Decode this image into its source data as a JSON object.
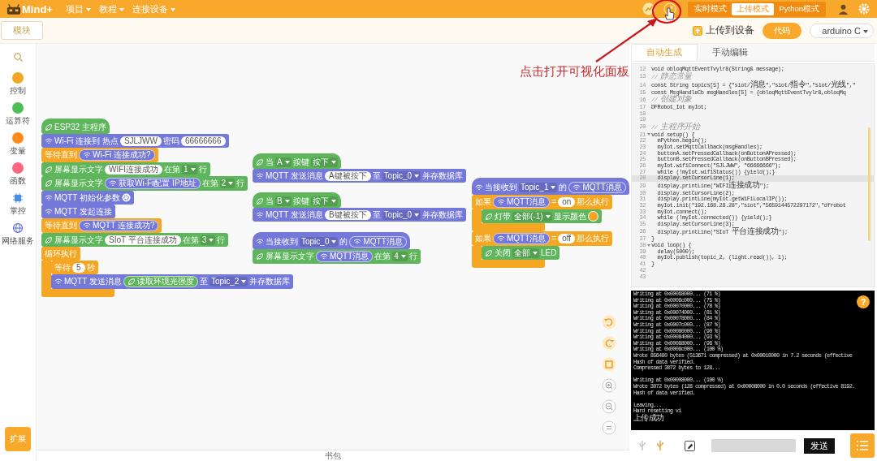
{
  "topbar": {
    "logo": "Mind+",
    "menus": [
      {
        "label": "项目"
      },
      {
        "label": "教程"
      },
      {
        "label": "连接设备"
      }
    ],
    "modes": [
      {
        "label": "实时模式",
        "selected": false
      },
      {
        "label": "上传模式",
        "selected": true
      },
      {
        "label": "Python模式",
        "selected": false
      }
    ]
  },
  "toolbar": {
    "module_button": "模块",
    "upload_button": "上传到设备",
    "assistant_button": "代码",
    "board_select": "arduino C"
  },
  "categories": [
    {
      "label": "控制",
      "kind": "dot",
      "color": "#f5a623"
    },
    {
      "label": "运算符",
      "kind": "dot",
      "color": "#4cbf56"
    },
    {
      "label": "变量",
      "kind": "dot",
      "color": "#ff8c1a"
    },
    {
      "label": "函数",
      "kind": "dot",
      "color": "#ff6680"
    },
    {
      "label": "掌控",
      "kind": "chip"
    },
    {
      "label": "网络服务",
      "kind": "globe"
    }
  ],
  "extension_button": "扩展",
  "stacks": [
    {
      "blocks": [
        {
          "kind": "leaf",
          "hat": true,
          "parts": [
            {
              "kind": "text",
              "text": "ESP32 主程序"
            }
          ]
        },
        {
          "kind": "wifi",
          "hat": false,
          "parts": [
            {
              "kind": "text",
              "text": "Wi-Fi 连接到 热点"
            },
            {
              "kind": "input",
              "text": "SJLJWW"
            },
            {
              "kind": "text",
              "text": "密码"
            },
            {
              "kind": "input",
              "text": "66666666"
            }
          ]
        },
        {
          "kind": "control",
          "hat": false,
          "parts": [
            {
              "kind": "text",
              "text": "等待直到"
            },
            {
              "kind": "wifi",
              "text": "Wi-Fi 连接成功?"
            }
          ]
        },
        {
          "kind": "leaf",
          "hat": false,
          "parts": [
            {
              "kind": "text",
              "text": "屏幕显示文字"
            },
            {
              "kind": "input",
              "text": "WIFI连接成功"
            },
            {
              "kind": "text",
              "text": "在第"
            },
            {
              "kind": "drop",
              "text": "1"
            },
            {
              "kind": "text",
              "text": "行"
            }
          ]
        },
        {
          "kind": "leaf",
          "hat": false,
          "parts": [
            {
              "kind": "text",
              "text": "屏幕显示文字"
            },
            {
              "kind": "wifi",
              "text": "获取Wi-Fi配置 IP地址"
            },
            {
              "kind": "text",
              "text": "在第"
            },
            {
              "kind": "drop",
              "text": "2"
            },
            {
              "kind": "text",
              "text": "行"
            }
          ]
        },
        {
          "kind": "wifi",
          "hat": false,
          "parts": [
            {
              "kind": "text",
              "text": "MQTT 初始化参数"
            },
            {
              "kind": "gear"
            }
          ]
        },
        {
          "kind": "wifi",
          "hat": false,
          "parts": [
            {
              "kind": "text",
              "text": "MQTT 发起连接"
            }
          ]
        },
        {
          "kind": "control",
          "hat": false,
          "parts": [
            {
              "kind": "text",
              "text": "等待直到"
            },
            {
              "kind": "wifi",
              "text": "MQTT 连接成功?"
            }
          ]
        },
        {
          "kind": "leaf",
          "hat": false,
          "parts": [
            {
              "kind": "text",
              "text": "屏幕显示文字"
            },
            {
              "kind": "input",
              "text": "SIoT 平台连接成功"
            },
            {
              "kind": "text",
              "text": "在第"
            },
            {
              "kind": "drop",
              "text": "3"
            },
            {
              "kind": "text",
              "text": "行"
            }
          ]
        },
        {
          "kind": "control",
          "hat": false,
          "parts": [
            {
              "kind": "text",
              "text": "循环执行"
            }
          ],
          "children": [
            {
              "kind": "control",
              "hat": false,
              "parts": [
                {
                  "kind": "text",
                  "text": "等待"
                },
                {
                  "kind": "input",
                  "text": "5"
                },
                {
                  "kind": "text",
                  "text": "秒"
                }
              ]
            },
            {
              "kind": "wifi",
              "hat": false,
              "parts": [
                {
                  "kind": "text",
                  "text": "MQTT 发送消息"
                },
                {
                  "kind": "leaf",
                  "text": "读取环境光强度"
                },
                {
                  "kind": "text",
                  "text": "至"
                },
                {
                  "kind": "drop",
                  "text": "Topic_2"
                },
                {
                  "kind": "text",
                  "text": "并存数据库"
                }
              ]
            }
          ]
        }
      ]
    },
    {
      "blocks": [
        {
          "kind": "leaf",
          "hat": true,
          "parts": [
            {
              "kind": "text",
              "text": "当"
            },
            {
              "kind": "drop",
              "text": "A"
            },
            {
              "kind": "text",
              "text": "按键"
            },
            {
              "kind": "drop",
              "text": "按下"
            }
          ]
        },
        {
          "kind": "wifi",
          "hat": false,
          "parts": [
            {
              "kind": "text",
              "text": "MQTT 发送消息"
            },
            {
              "kind": "input",
              "text": "A键被按下"
            },
            {
              "kind": "text",
              "text": "至"
            },
            {
              "kind": "drop",
              "text": "Topic_0"
            },
            {
              "kind": "text",
              "text": "并存数据库"
            }
          ]
        }
      ]
    },
    {
      "blocks": [
        {
          "kind": "leaf",
          "hat": true,
          "parts": [
            {
              "kind": "text",
              "text": "当"
            },
            {
              "kind": "drop",
              "text": "B"
            },
            {
              "kind": "text",
              "text": "按键"
            },
            {
              "kind": "drop",
              "text": "按下"
            }
          ]
        },
        {
          "kind": "wifi",
          "hat": false,
          "parts": [
            {
              "kind": "text",
              "text": "MQTT 发送消息"
            },
            {
              "kind": "input",
              "text": "B键被按下"
            },
            {
              "kind": "text",
              "text": "至"
            },
            {
              "kind": "drop",
              "text": "Topic_0"
            },
            {
              "kind": "text",
              "text": "并存数据库"
            }
          ]
        }
      ]
    },
    {
      "blocks": [
        {
          "kind": "wifi",
          "hat": true,
          "parts": [
            {
              "kind": "text",
              "text": "当接收到"
            },
            {
              "kind": "drop",
              "text": "Topic_0"
            },
            {
              "kind": "text",
              "text": "的"
            },
            {
              "kind": "wifi",
              "text": "MQTT消息"
            }
          ]
        },
        {
          "kind": "leaf",
          "hat": false,
          "parts": [
            {
              "kind": "text",
              "text": "屏幕显示文字"
            },
            {
              "kind": "wifi",
              "text": "MQTT消息"
            },
            {
              "kind": "text",
              "text": "在第"
            },
            {
              "kind": "drop",
              "text": "4"
            },
            {
              "kind": "text",
              "text": "行"
            }
          ]
        }
      ]
    },
    {
      "blocks": [
        {
          "kind": "wifi",
          "hat": true,
          "parts": [
            {
              "kind": "text",
              "text": "当接收到"
            },
            {
              "kind": "drop",
              "text": "Topic_1"
            },
            {
              "kind": "text",
              "text": "的"
            },
            {
              "kind": "wifi",
              "text": "MQTT消息"
            }
          ]
        },
        {
          "kind": "control",
          "hat": false,
          "parts": [
            {
              "kind": "text",
              "text": "如果"
            },
            {
              "kind": "wifi",
              "text": "MQTT消息"
            },
            {
              "kind": "text",
              "text": "="
            },
            {
              "kind": "input",
              "text": "on"
            },
            {
              "kind": "text",
              "text": "那么执行"
            }
          ],
          "children": [
            {
              "kind": "leaf",
              "hat": false,
              "parts": [
                {
                  "kind": "text",
                  "text": "灯带"
                },
                {
                  "kind": "drop",
                  "text": "全部(-1)"
                },
                {
                  "kind": "text",
                  "text": "显示颜色"
                },
                {
                  "kind": "swatch",
                  "color": "#f7a325"
                }
              ]
            }
          ]
        },
        {
          "kind": "control",
          "hat": false,
          "parts": [
            {
              "kind": "text",
              "text": "如果"
            },
            {
              "kind": "wifi",
              "text": "MQTT消息"
            },
            {
              "kind": "text",
              "text": "="
            },
            {
              "kind": "input",
              "text": "off"
            },
            {
              "kind": "text",
              "text": "那么执行"
            }
          ],
          "children": [
            {
              "kind": "leaf",
              "hat": false,
              "parts": [
                {
                  "kind": "text",
                  "text": "关闭"
                },
                {
                  "kind": "drop",
                  "text": "全部"
                },
                {
                  "kind": "text",
                  "text": "LED"
                }
              ]
            }
          ]
        }
      ]
    }
  ],
  "backpack": "书包",
  "editor": {
    "tabs": [
      {
        "label": "自动生成",
        "selected": true
      },
      {
        "label": "手动编辑",
        "selected": false
      }
    ],
    "lines": [
      {
        "n": "12",
        "kind": "code",
        "fold": false,
        "current": false,
        "text": "void obloqMqttEventTvylr8(String& message);"
      },
      {
        "n": "13",
        "kind": "comment",
        "fold": false,
        "current": false,
        "text": "// 静态常量"
      },
      {
        "n": "14",
        "kind": "code",
        "fold": false,
        "current": false,
        "text": "const String topics[5] = {\"siot/消息\",\"siot/指令\",\"siot/光线\",\""
      },
      {
        "n": "15",
        "kind": "code",
        "fold": false,
        "current": false,
        "text": "const MsgHandleCb msgHandles[5] = {obloqMqttEventTvylr8,obloqMq"
      },
      {
        "n": "16",
        "kind": "comment",
        "fold": false,
        "current": false,
        "text": "// 创建对象"
      },
      {
        "n": "17",
        "kind": "code",
        "fold": false,
        "current": false,
        "text": "DFRobot_Iot myIot;"
      },
      {
        "n": "18",
        "kind": "code",
        "fold": false,
        "current": false
      },
      {
        "n": "19",
        "kind": "code",
        "fold": false,
        "current": false
      },
      {
        "n": "20",
        "kind": "comment",
        "fold": false,
        "current": false,
        "text": "// 主程序开始"
      },
      {
        "n": "21",
        "kind": "code",
        "fold": true,
        "current": false,
        "text": "void setup() {"
      },
      {
        "n": "22",
        "kind": "code",
        "fold": false,
        "current": false,
        "text": "  mPython.begin();"
      },
      {
        "n": "23",
        "kind": "code",
        "fold": false,
        "current": false,
        "text": "  myIot.setMqttCallback(msgHandles);"
      },
      {
        "n": "24",
        "kind": "code",
        "fold": false,
        "current": false,
        "text": "  buttonA.setPressedCallback(onButtonAPressed);"
      },
      {
        "n": "25",
        "kind": "code",
        "fold": false,
        "current": false,
        "text": "  buttonB.setPressedCallback(onButtonBPressed);"
      },
      {
        "n": "26",
        "kind": "code",
        "fold": false,
        "current": false,
        "text": "  myIot.wifiConnect(\"SJLJWW\", \"66666666\");"
      },
      {
        "n": "27",
        "kind": "code",
        "fold": false,
        "current": false,
        "text": "  while (!myIot.wifiStatus()) {yield();}"
      },
      {
        "n": "28",
        "kind": "code",
        "fold": false,
        "current": true,
        "text": "  display.setCursorLine(1);"
      },
      {
        "n": "29",
        "kind": "code",
        "fold": false,
        "current": false,
        "text": "  display.printLine(\"WIFI连接成功\");"
      },
      {
        "n": "30",
        "kind": "code",
        "fold": false,
        "current": false,
        "text": "  display.setCursorLine(2);"
      },
      {
        "n": "31",
        "kind": "code",
        "fold": false,
        "current": false,
        "text": "  display.printLine(myIot.getWiFiLocalIP());"
      },
      {
        "n": "32",
        "kind": "code",
        "fold": false,
        "current": false,
        "text": "  myIot.init(\"192.168.28.28\",\"siot\",\"5659144572297172\",\"dfrobot"
      },
      {
        "n": "33",
        "kind": "code",
        "fold": false,
        "current": false,
        "text": "  myIot.connect();"
      },
      {
        "n": "34",
        "kind": "code",
        "fold": false,
        "current": false,
        "text": "  while (!myIot.connected()) {yield();}"
      },
      {
        "n": "35",
        "kind": "code",
        "fold": false,
        "current": false,
        "text": "  display.setCursorLine(3);"
      },
      {
        "n": "36",
        "kind": "code",
        "fold": false,
        "current": false,
        "text": "  display.printLine(\"SIoT 平台连接成功\");"
      },
      {
        "n": "37",
        "kind": "code",
        "fold": false,
        "current": false,
        "text": "}"
      },
      {
        "n": "38",
        "kind": "code",
        "fold": true,
        "current": false,
        "text": "void loop() {"
      },
      {
        "n": "39",
        "kind": "code",
        "fold": false,
        "current": false,
        "text": "  delay(5000);"
      },
      {
        "n": "40",
        "kind": "code",
        "fold": false,
        "current": false,
        "text": "  myIot.publish(topic_2, (light.read()), 1);"
      },
      {
        "n": "41",
        "kind": "code",
        "fold": false,
        "current": false,
        "text": "}"
      },
      {
        "n": "42",
        "kind": "code",
        "fold": false,
        "current": false
      },
      {
        "n": "43",
        "kind": "code",
        "fold": false,
        "current": false
      }
    ]
  },
  "console": {
    "help_button": "?",
    "lines": [
      {
        "kind": "text",
        "text": "Writing at 0x00068000... (71 %)"
      },
      {
        "kind": "text",
        "text": "Writing at 0x0006c000... (75 %)"
      },
      {
        "kind": "text",
        "text": "Writing at 0x00070000... (78 %)"
      },
      {
        "kind": "text",
        "text": "Writing at 0x00074000... (81 %)"
      },
      {
        "kind": "text",
        "text": "Writing at 0x00078000... (84 %)"
      },
      {
        "kind": "text",
        "text": "Writing at 0x0007c000... (87 %)"
      },
      {
        "kind": "text",
        "text": "Writing at 0x00080000... (90 %)"
      },
      {
        "kind": "text",
        "text": "Writing at 0x00084000... (93 %)"
      },
      {
        "kind": "text",
        "text": "Writing at 0x00088000... (96 %)"
      },
      {
        "kind": "text",
        "text": "Writing at 0x0008c000... (100 %)"
      },
      {
        "kind": "text",
        "text": "Wrote 856480 bytes (513671 compressed) at 0x00010000 in 7.2 seconds (effective"
      },
      {
        "kind": "text",
        "text": "Hash of data verified."
      },
      {
        "kind": "text",
        "text": "Compressed 3072 bytes to 128..."
      },
      {
        "kind": "blank"
      },
      {
        "kind": "text",
        "text": "Writing at 0x00008000... (100 %)"
      },
      {
        "kind": "text",
        "text": "Wrote 3072 bytes (128 compressed) at 0x00008000 in 0.0 seconds (effective 8192."
      },
      {
        "kind": "text",
        "text": "Hash of data verified."
      },
      {
        "kind": "blank"
      },
      {
        "kind": "text",
        "text": "Leaving..."
      },
      {
        "kind": "text",
        "text": "Hard resetting vi"
      },
      {
        "kind": "text",
        "text": "上传成功"
      }
    ]
  },
  "serial": {
    "send_button": "发送"
  },
  "annotation": {
    "text": "点击打开可视化面板"
  }
}
